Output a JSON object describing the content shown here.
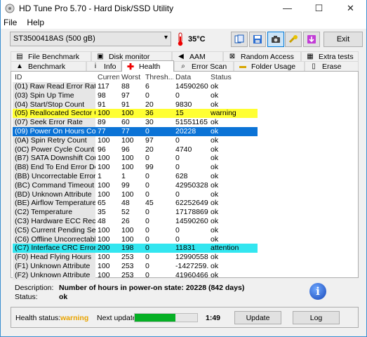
{
  "window": {
    "title": "HD Tune Pro 5.70 - Hard Disk/SSD Utility",
    "minimize": "—",
    "maximize": "☐",
    "close": "✕"
  },
  "menu": {
    "file": "File",
    "help": "Help"
  },
  "toolbar": {
    "drive": "ST3500418AS (500 gB)",
    "temperature": "35°C",
    "exit_label": "Exit"
  },
  "tabs": {
    "row1": [
      "File Benchmark",
      "Disk monitor",
      "AAM",
      "Random Access",
      "Extra tests"
    ],
    "row2": [
      "Benchmark",
      "Info",
      "Health",
      "Error Scan",
      "Folder Usage",
      "Erase"
    ],
    "selected": "Health"
  },
  "table": {
    "headers": [
      "ID",
      "Current",
      "Worst",
      "Thresh...",
      "Data",
      "Status"
    ],
    "rows": [
      [
        "(01) Raw Read Error Rate",
        "117",
        "88",
        "6",
        "145902608",
        "ok"
      ],
      [
        "(03) Spin Up Time",
        "98",
        "97",
        "0",
        "0",
        "ok"
      ],
      [
        "(04) Start/Stop Count",
        "91",
        "91",
        "20",
        "9830",
        "ok"
      ],
      [
        "(05) Reallocated Sector Count",
        "100",
        "100",
        "36",
        "15",
        "warning"
      ],
      [
        "(07) Seek Error Rate",
        "89",
        "60",
        "30",
        "51551165...",
        "ok"
      ],
      [
        "(09) Power On Hours Count",
        "77",
        "77",
        "0",
        "20228",
        "ok"
      ],
      [
        "(0A) Spin Retry Count",
        "100",
        "100",
        "97",
        "0",
        "ok"
      ],
      [
        "(0C) Power Cycle Count",
        "96",
        "96",
        "20",
        "4740",
        "ok"
      ],
      [
        "(B7) SATA Downshift Count",
        "100",
        "100",
        "0",
        "0",
        "ok"
      ],
      [
        "(B8) End To End Error Detect...",
        "100",
        "100",
        "99",
        "0",
        "ok"
      ],
      [
        "(BB) Uncorrectable Error Cou...",
        "1",
        "1",
        "0",
        "628",
        "ok"
      ],
      [
        "(BC) Command Timeout",
        "100",
        "99",
        "0",
        "42950328...",
        "ok"
      ],
      [
        "(BD) Unknown Attribute",
        "100",
        "100",
        "0",
        "0",
        "ok"
      ],
      [
        "(BE) Airflow Temperature",
        "65",
        "48",
        "45",
        "622526499",
        "ok"
      ],
      [
        "(C2) Temperature",
        "35",
        "52",
        "0",
        "17178869...",
        "ok"
      ],
      [
        "(C3) Hardware ECC Recover...",
        "48",
        "26",
        "0",
        "145902608",
        "ok"
      ],
      [
        "(C5) Current Pending Sector",
        "100",
        "100",
        "0",
        "0",
        "ok"
      ],
      [
        "(C6) Offline Uncorrectable",
        "100",
        "100",
        "0",
        "0",
        "ok"
      ],
      [
        "(C7) Interface CRC Error Count",
        "200",
        "198",
        "0",
        "11831",
        "attention"
      ],
      [
        "(F0) Head Flying Hours",
        "100",
        "253",
        "0",
        "12990558...",
        "ok"
      ],
      [
        "(F1) Unknown Attribute",
        "100",
        "253",
        "0",
        "-1427259...",
        "ok"
      ],
      [
        "(F2) Unknown Attribute",
        "100",
        "253",
        "0",
        "419604664",
        "ok"
      ]
    ],
    "selected_row": 5
  },
  "description": {
    "label": "Description:",
    "value": "Number of hours in power-on state: 20228 (842 days)",
    "status_label": "Status:",
    "status_value": "ok"
  },
  "status": {
    "health_label": "Health status:",
    "health_value": "warning",
    "next_update_label": "Next update:",
    "progress_fraction": 0.65,
    "time": "1:49",
    "update_label": "Update",
    "log_label": "Log"
  },
  "colors": {
    "warning_row": "#ffff33",
    "attention_row": "#33e6f0",
    "selected_row": "#0b73d6",
    "health_warning": "#e8a300"
  },
  "icons": {
    "app": "hdtune-icon",
    "thermometer": "thermometer-icon",
    "info": "info-icon"
  }
}
